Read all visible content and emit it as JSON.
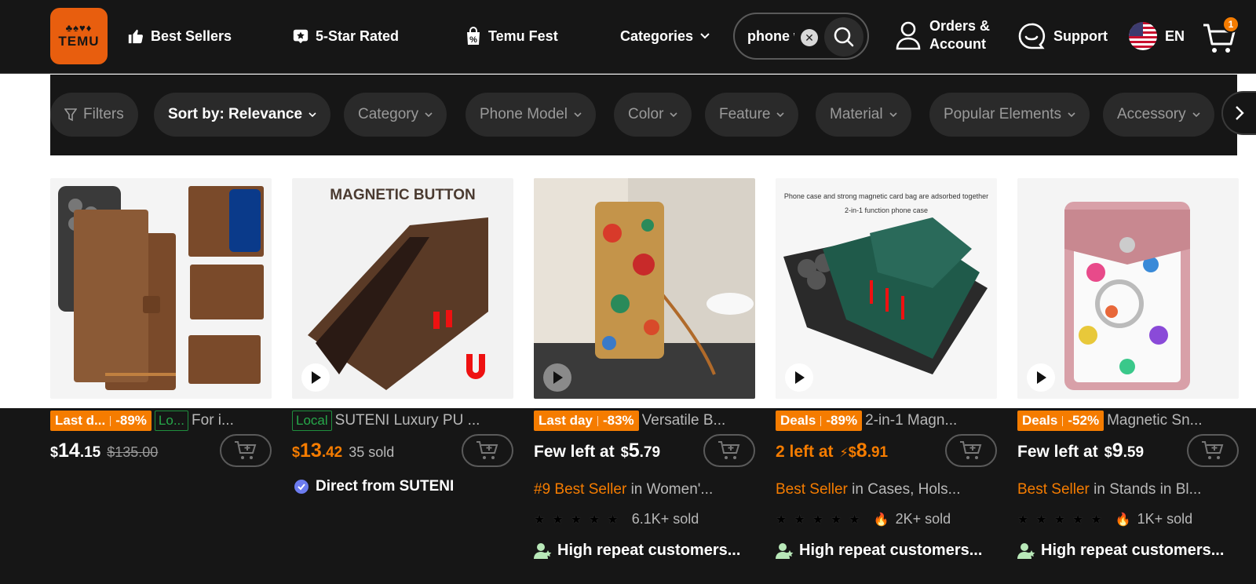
{
  "header": {
    "logo": {
      "glyphs": "♣♠♥♦",
      "word": "TEMU"
    },
    "nav": [
      {
        "label": "Best Sellers",
        "icon": "thumbs-up-icon"
      },
      {
        "label": "5-Star Rated",
        "icon": "star-badge-icon"
      },
      {
        "label": "Temu Fest",
        "icon": "percent-bag-icon"
      },
      {
        "label": "Categories",
        "icon": "chevron-down-icon"
      }
    ],
    "search": {
      "value": "phone w",
      "clear_icon": "✕"
    },
    "account": {
      "line1": "Orders &",
      "line2": "Account"
    },
    "support": "Support",
    "language": "EN",
    "cart_count": "1"
  },
  "filters": {
    "filters_label": "Filters",
    "sort_label": "Sort by: Relevance",
    "chips": [
      "Category",
      "Phone Model",
      "Color",
      "Feature",
      "Material",
      "Popular Elements",
      "Accessory"
    ]
  },
  "products": [
    {
      "badge": "Last d...",
      "discount": "-89%",
      "local": "Lo...",
      "title": "For i...",
      "price_cur": "$",
      "price_big": "14",
      "price_small": ".15",
      "orig_price": "$135.00"
    },
    {
      "local": "Local",
      "title": "SUTENI Luxury PU ...",
      "price_cur": "$",
      "price_big": "13",
      "price_small": ".42",
      "sold": "35 sold",
      "direct": "Direct from SUTENI",
      "image_caption": "MAGNETIC BUTTON"
    },
    {
      "badge": "Last day",
      "discount": "-83%",
      "title": "Versatile B...",
      "lead": "Few left at",
      "price_cur": "$",
      "price_big": "5",
      "price_small": ".79",
      "rank_hl": "#9 Best Seller",
      "rank_rest": "in Women'...",
      "sold": "6.1K+ sold",
      "repeat": "High repeat customers..."
    },
    {
      "badge": "Deals",
      "discount": "-89%",
      "title": "2-in-1 Magn...",
      "lead": "2 left at",
      "price_cur": "$",
      "price_big": "8",
      "price_small": ".91",
      "rank_hl": "Best Seller",
      "rank_rest": "in Cases, Hols...",
      "sold": "2K+ sold",
      "repeat": "High repeat customers...",
      "image_caption1": "Phone case and strong magnetic card bag are adsorbed together",
      "image_caption2": "2-in-1 function phone case"
    },
    {
      "badge": "Deals",
      "discount": "-52%",
      "title": "Magnetic Sn...",
      "lead": "Few left at",
      "price_cur": "$",
      "price_big": "9",
      "price_small": ".59",
      "rank_hl": "Best Seller",
      "rank_rest": "in Stands in Bl...",
      "sold": "1K+ sold",
      "repeat": "High repeat customers..."
    }
  ],
  "stars_text": "★★★★★",
  "colors": {
    "accent": "#f57c00",
    "logo": "#e85e0e",
    "bg": "#161616",
    "green": "#27a84a"
  }
}
